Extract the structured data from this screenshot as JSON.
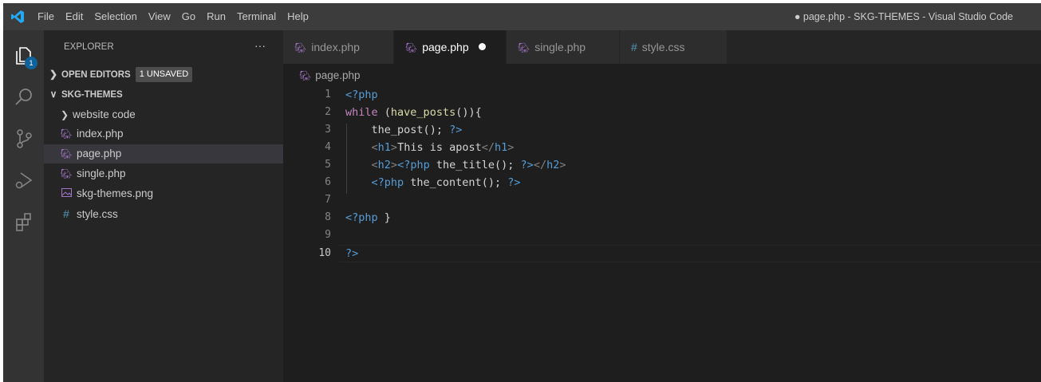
{
  "menu": {
    "items": [
      "File",
      "Edit",
      "Selection",
      "View",
      "Go",
      "Run",
      "Terminal",
      "Help"
    ],
    "window_title": "● page.php - SKG-THEMES - Visual Studio Code"
  },
  "activity_bar": {
    "explorer_badge": "1"
  },
  "sidebar": {
    "title": "EXPLORER",
    "more": "···",
    "open_editors_label": "OPEN EDITORS",
    "unsaved_badge": "1 UNSAVED",
    "workspace_label": "SKG-THEMES",
    "folder": "website code",
    "files": [
      {
        "name": "index.php",
        "icon": "php-elephant-icon"
      },
      {
        "name": "page.php",
        "icon": "php-elephant-icon"
      },
      {
        "name": "single.php",
        "icon": "php-elephant-icon"
      },
      {
        "name": "skg-themes.png",
        "icon": "image-icon"
      },
      {
        "name": "style.css",
        "icon": "css-hash-icon"
      }
    ],
    "selected_file": "page.php"
  },
  "tabs": [
    {
      "label": "index.php",
      "active": false
    },
    {
      "label": "page.php",
      "active": true,
      "dirty": true
    },
    {
      "label": "single.php",
      "active": false
    },
    {
      "label": "style.css",
      "active": false
    }
  ],
  "editor": {
    "breadcrumb": "page.php",
    "current_line": "10",
    "line_numbers": [
      "1",
      "2",
      "3",
      "4",
      "5",
      "6",
      "7",
      "8",
      "9",
      "10"
    ],
    "lines": [
      "<?php",
      "while (have_posts()){",
      "    the_post(); ?>",
      "    <h1>This is apost</h1>",
      "    <h2><?php the_title(); ?></h2>",
      "    <?php the_content(); ?>",
      "",
      "<?php }",
      "",
      "?>"
    ]
  },
  "colors": {
    "titlebar": "#3c3c3c",
    "activity_bar": "#333333",
    "sidebar": "#252526",
    "editor": "#1e1e1e",
    "accent_badge": "#0e639c",
    "php_icon": "#a074c4",
    "css_icon": "#519aba"
  }
}
